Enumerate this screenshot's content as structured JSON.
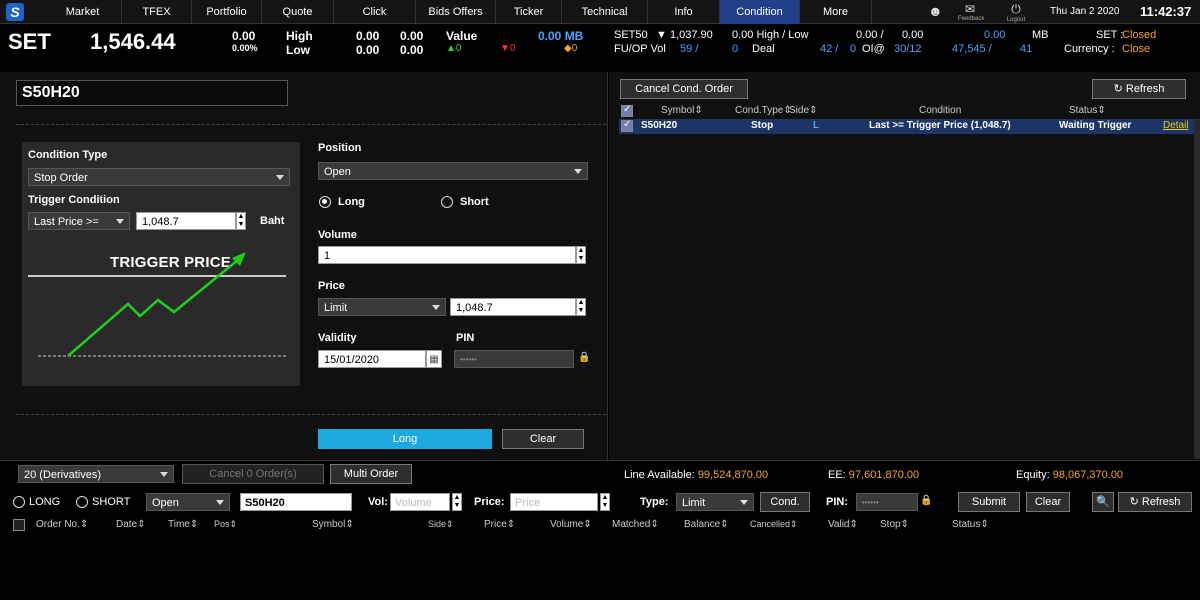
{
  "nav": {
    "logo": "S",
    "tabs": [
      "Market",
      "TFEX",
      "Portfolio",
      "Quote",
      "Click",
      "Bids Offers",
      "Ticker",
      "Technical",
      "Info",
      "Condition",
      "More"
    ],
    "active_tab": "Condition",
    "feedback_label": "Feedback",
    "logout_label": "Logout",
    "date": "Thu Jan 2 2020",
    "time": "11:42:37"
  },
  "ticker": {
    "index_name": "SET",
    "index_value": "1,546.44",
    "change": "0.00",
    "change_pct": "0.00%",
    "high_label": "High",
    "low_label": "Low",
    "high1": "0.00",
    "high2": "0.00",
    "low1": "0.00",
    "low2": "0.00",
    "value_label": "Value",
    "value_up": "0",
    "value_down": "0",
    "value_mb": "0.00 MB",
    "value_unch": "0",
    "set50_label": "SET50",
    "set50_value": "1,037.90",
    "set50_highlow": "0.00 High / Low",
    "set50_hl_val1": "0.00 /",
    "set50_hl_val2": "0.00",
    "set50_mb_val": "0.00",
    "set50_mb": "MB",
    "fuop_label": "FU/OP Vol",
    "fuop_vol": "59 /",
    "fuop_deal_num": "0",
    "fuop_deal": "Deal",
    "fuop_num2": "42 /",
    "fuop_oi_num": "0",
    "fuop_oi": "OI@",
    "fuop_oi_date": "30/12",
    "fuop_num3": "47,545 /",
    "fuop_num4": "41",
    "set_status_label": "SET :",
    "set_status": "Closed",
    "currency_label": "Currency :",
    "currency": "Close"
  },
  "order_form": {
    "symbol": "S50H20",
    "condition_type_label": "Condition Type",
    "condition_type": "Stop Order",
    "trigger_condition_label": "Trigger Condition",
    "trigger_operator": "Last Price >=",
    "trigger_value": "1,048.7",
    "trigger_unit": "Baht",
    "trigger_graphic_label": "TRIGGER PRICE",
    "position_label": "Position",
    "position": "Open",
    "long_label": "Long",
    "short_label": "Short",
    "volume_label": "Volume",
    "volume": "1",
    "price_label": "Price",
    "price_type": "Limit",
    "price": "1,048.7",
    "validity_label": "Validity",
    "validity": "15/01/2020",
    "pin_label": "PIN",
    "pin_value": "••••••",
    "submit_label": "Long",
    "clear_label": "Clear"
  },
  "cond_orders": {
    "cancel_label": "Cancel Cond. Order",
    "refresh_label": "Refresh",
    "headers": [
      "Symbol",
      "Cond.Type",
      "Side",
      "Condition",
      "Status"
    ],
    "rows": [
      {
        "symbol": "S50H20",
        "cond_type": "Stop",
        "side": "L",
        "condition": "Last >= Trigger Price (1,048.7)",
        "status": "Waiting Trigger",
        "detail": "Detail"
      }
    ]
  },
  "order_bar": {
    "account": "20 (Derivatives)",
    "cancel_orders": "Cancel 0 Order(s)",
    "multi_order": "Multi Order",
    "line_available_label": "Line Available:",
    "line_available": "99,524,870.00",
    "ee_label": "EE:",
    "ee": "97,601,870.00",
    "equity_label": "Equity:",
    "equity": "98,067,370.00",
    "long_label": "LONG",
    "short_label": "SHORT",
    "position": "Open",
    "symbol": "S50H20",
    "vol_label": "Vol:",
    "vol_placeholder": "Volume",
    "price_label": "Price:",
    "price_placeholder": "Price",
    "type_label": "Type:",
    "type": "Limit",
    "cond_label": "Cond.",
    "pin_label": "PIN:",
    "pin_value": "••••••",
    "submit_label": "Submit",
    "clear_label": "Clear",
    "refresh_label": "Refresh"
  },
  "orders_table": {
    "headers": [
      "Order No.",
      "Date",
      "Time",
      "Pos",
      "Symbol",
      "Side",
      "Price",
      "Volume",
      "Matched",
      "Balance",
      "Cancelled",
      "Valid",
      "Stop",
      "Status"
    ]
  }
}
